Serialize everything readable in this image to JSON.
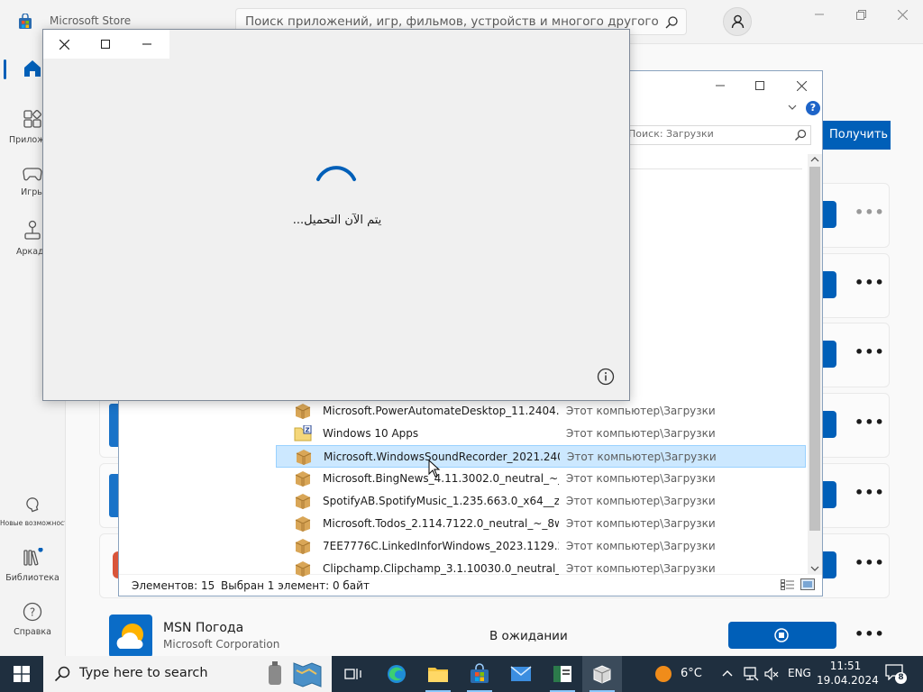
{
  "store": {
    "title": "Microsoft Store",
    "search_placeholder": "Поиск приложений, игр, фильмов, устройств и многого другого",
    "nav": [
      {
        "label": "Главная"
      },
      {
        "label": "Приложения"
      },
      {
        "label": "Игры"
      },
      {
        "label": "Аркада"
      },
      {
        "label": "Новые возможности"
      },
      {
        "label": "Библиотека"
      },
      {
        "label": "Справка"
      }
    ],
    "refresh_label": "Получить обновления",
    "more_label": "•••",
    "msn": {
      "name": "MSN Погода",
      "publisher": "Microsoft Corporation",
      "status": "В ожидании"
    }
  },
  "file_dialog": {
    "search_placeholder": "Поиск: Загрузки",
    "help_label": "?",
    "files": [
      {
        "name": "Microsoft.PowerAutomateDesktop_11.2404.195...",
        "location": "Этот компьютер\\Загрузки",
        "icon": "package-icon"
      },
      {
        "name": "Windows 10 Apps",
        "location": "Этот компьютер\\Загрузки",
        "icon": "zip-folder-icon"
      },
      {
        "name": "Microsoft.WindowsSoundRecorder_2021.2403....",
        "location": "Этот компьютер\\Загрузки",
        "icon": "package-icon",
        "selected": true
      },
      {
        "name": "Microsoft.BingNews_4.11.3002.0_neutral_~_8w...",
        "location": "Этот компьютер\\Загрузки",
        "icon": "package-icon"
      },
      {
        "name": "SpotifyAB.SpotifyMusic_1.235.663.0_x64__zpdn...",
        "location": "Этот компьютер\\Загрузки",
        "icon": "package-icon"
      },
      {
        "name": "Microsoft.Todos_2.114.7122.0_neutral_~_8weky...",
        "location": "Этот компьютер\\Загрузки",
        "icon": "package-icon"
      },
      {
        "name": "7EE7776C.LinkedInforWindows_2023.1129.2326....",
        "location": "Этот компьютер\\Загрузки",
        "icon": "package-icon"
      },
      {
        "name": "Clipchamp.Clipchamp_3.1.10030.0_neutral_~_y...",
        "location": "Этот компьютер\\Загрузки",
        "icon": "package-icon"
      }
    ],
    "status_count": "Элементов: 15",
    "status_selected": "Выбран 1 элемент: 0 байт"
  },
  "loading": {
    "text": "يتم الآن التحميل..."
  },
  "taskbar": {
    "search_placeholder": "Type here to search",
    "weather": "6°C",
    "language": "ENG",
    "time": "11:51",
    "date": "19.04.2024",
    "notifications": "8"
  },
  "colors": {
    "accent": "#005fb8",
    "taskbar": "#1f2f3f",
    "selection": "#cce8ff"
  }
}
